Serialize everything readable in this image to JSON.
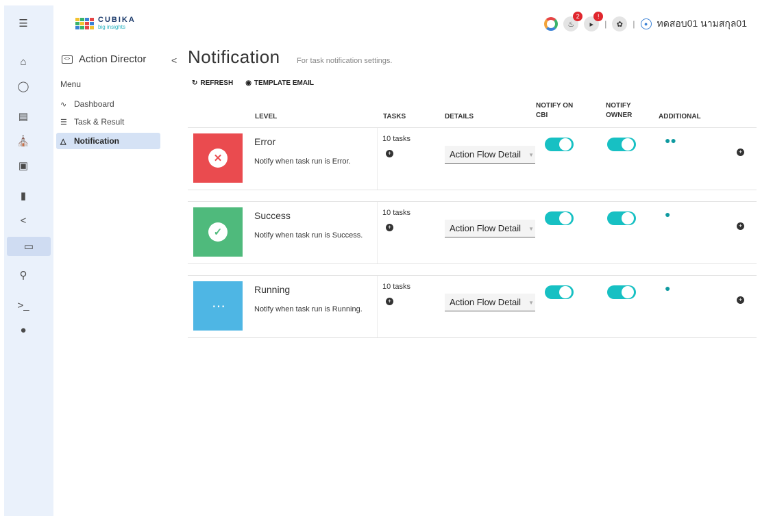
{
  "brand": {
    "name": "CUBIKA",
    "tagline": "big insights"
  },
  "header": {
    "notifications_badge": "2",
    "announcements_badge": "!",
    "user_name": "ทดสอบ01 นามสกุล01"
  },
  "rail": {
    "items": [
      "menu-icon",
      "home-icon",
      "circle-icon",
      "server-icon",
      "bank-icon",
      "archive-icon",
      "file-lock-icon",
      "share-icon",
      "action-director-icon",
      "key-icon",
      "terminal-icon",
      "user-icon"
    ],
    "active": "action-director-icon"
  },
  "sidebar": {
    "title": "Action Director",
    "menu_label": "Menu",
    "items": [
      {
        "label": "Dashboard",
        "icon": "chart-icon"
      },
      {
        "label": "Task & Result",
        "icon": "list-icon"
      },
      {
        "label": "Notification",
        "icon": "bell-icon",
        "active": true
      }
    ]
  },
  "page": {
    "title": "Notification",
    "subtitle": "For task notification settings.",
    "refresh_label": "REFRESH",
    "template_email_label": "TEMPLATE EMAIL"
  },
  "table": {
    "headers": {
      "level": "LEVEL",
      "tasks": "TASKS",
      "details": "DETAILS",
      "notify_cbi": [
        "NOTIFY ON",
        "CBI"
      ],
      "notify_owner": [
        "NOTIFY",
        "OWNER"
      ],
      "additional": "ADDITIONAL"
    },
    "rows": [
      {
        "level": "Error",
        "description": "Notify when task run is Error.",
        "tasks": "10 tasks",
        "details": "Action Flow Detail",
        "notify_cbi": true,
        "notify_owner": true,
        "color": "#ea4b4f",
        "icon": "x-icon",
        "additional_icon": "users-icon"
      },
      {
        "level": "Success",
        "description": "Notify when task run is Success.",
        "tasks": "10 tasks",
        "details": "Action Flow Detail",
        "notify_cbi": true,
        "notify_owner": true,
        "color": "#4fba7c",
        "icon": "check-icon",
        "additional_icon": "user-icon"
      },
      {
        "level": "Running",
        "description": "Notify when task run is Running.",
        "tasks": "10 tasks",
        "details": "Action Flow Detail",
        "notify_cbi": true,
        "notify_owner": true,
        "color": "#4eb6e4",
        "icon": "spinner-icon",
        "additional_icon": "user-icon"
      }
    ]
  }
}
